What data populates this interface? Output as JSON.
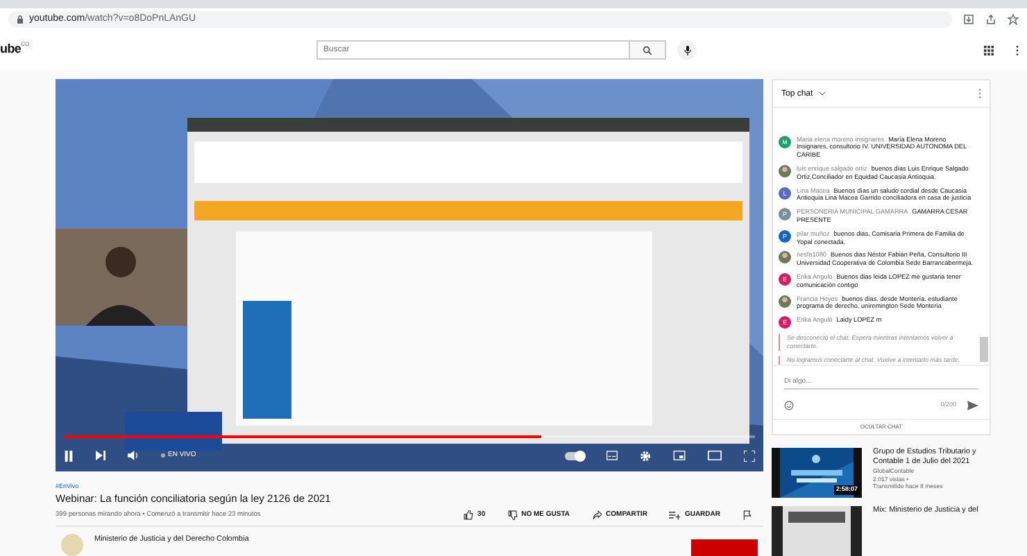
{
  "browser": {
    "url_host": "youtube.com",
    "url_path": "/watch?v=o8DoPnLAnGU"
  },
  "header": {
    "logo": "ube",
    "country": "CO",
    "search": {
      "placeholder": "Buscar"
    }
  },
  "player": {
    "playing": true,
    "live_label": "EN VIVO",
    "autoplay": true,
    "progress": {
      "level": 0.69
    }
  },
  "video": {
    "hashtag": "#EnVivo",
    "title": "Webinar: La función conciliatoria según la ley 2126 de 2021",
    "stats": "399 personas mirando ahora • Comenzó a transmitir hace 23 minutos",
    "likes": "30",
    "dislike": "NO ME GUSTA",
    "share": "COMPARTIR",
    "save": "GUARDAR"
  },
  "channel": {
    "name": "Ministerio de Justicia y del Derecho Colombia"
  },
  "chat": {
    "header": "Top chat",
    "messages": [
      {
        "author": "Maria elena moreno insignares",
        "text": "María Elena Moreno Insignares, consultorio IV. UNIVERSIDAD AUTONOMA DEL CARIBE",
        "avatar": {
          "kind": "letter",
          "initial": "M",
          "color": "#1e9e6a"
        }
      },
      {
        "author": "luis enrique salgado ortiz",
        "text": "buenos días Luis Enrique Salgado Ortiz,Conciliador en Equidad Caucasia Antioquia."
      },
      {
        "author": "Lina Macea",
        "text": "Buenos días un saludo cordial desde Caucasia Antioquia Lina Macea Garrido conciliadora en casa de justicia",
        "avatar": {
          "kind": "letter",
          "initial": "L",
          "color": "#5c6bc0"
        }
      },
      {
        "author": "PERSONERIA MUNICIPAL GAMARRA",
        "text": "GAMARRA CESAR PRESENTE",
        "avatar": {
          "kind": "letter",
          "initial": "P",
          "color": "#78909c"
        }
      },
      {
        "author": "pilar muñoz",
        "text": "buenos dias, Comisaria Primera de Familia de Yopal conectada.",
        "avatar": {
          "kind": "letter",
          "initial": "P",
          "color": "#1565c0"
        }
      },
      {
        "author": "nesfa1080",
        "text": "Buenos dias Néstor Fabián Peña, Consultorio III Universidad Cooperativa de Colombia Sede Barrancabermeja."
      },
      {
        "author": "Erika Angulo",
        "text": "Buenos dias leida LOPEZ me gustaria tener comunicación contigo",
        "avatar": {
          "kind": "letter",
          "initial": "E",
          "color": "#d81b60"
        }
      },
      {
        "author": "Francia Hoyos",
        "text": "buenos días. desde Montería. estudiante programa de derecho. uniremington Sede Montería"
      },
      {
        "author": "Erika Angulo",
        "text": "Laidy LOPEZ m",
        "avatar": {
          "kind": "letter",
          "initial": "E",
          "color": "#d81b60"
        }
      }
    ],
    "notices": [
      "Se desconectó el chat. Espera mientras intentamos volver a conectarte.",
      "No logramos conectarte al chat. Vuelve a intentarlo más tarde."
    ],
    "input": {
      "placeholder": "Di algo..."
    },
    "counter": "0/200",
    "hide_button": "OCULTAR CHAT"
  },
  "suggestions": [
    {
      "title": "Grupo de Estudios Tributario y Contable 1 de Julio del 2021",
      "channel": "GlobalContable",
      "views": "2.017 vistas •",
      "age": "Transmitido hace 8 meses",
      "duration": "2:58:07"
    },
    {
      "title": "Mix: Ministerio de Justicia y del"
    }
  ]
}
